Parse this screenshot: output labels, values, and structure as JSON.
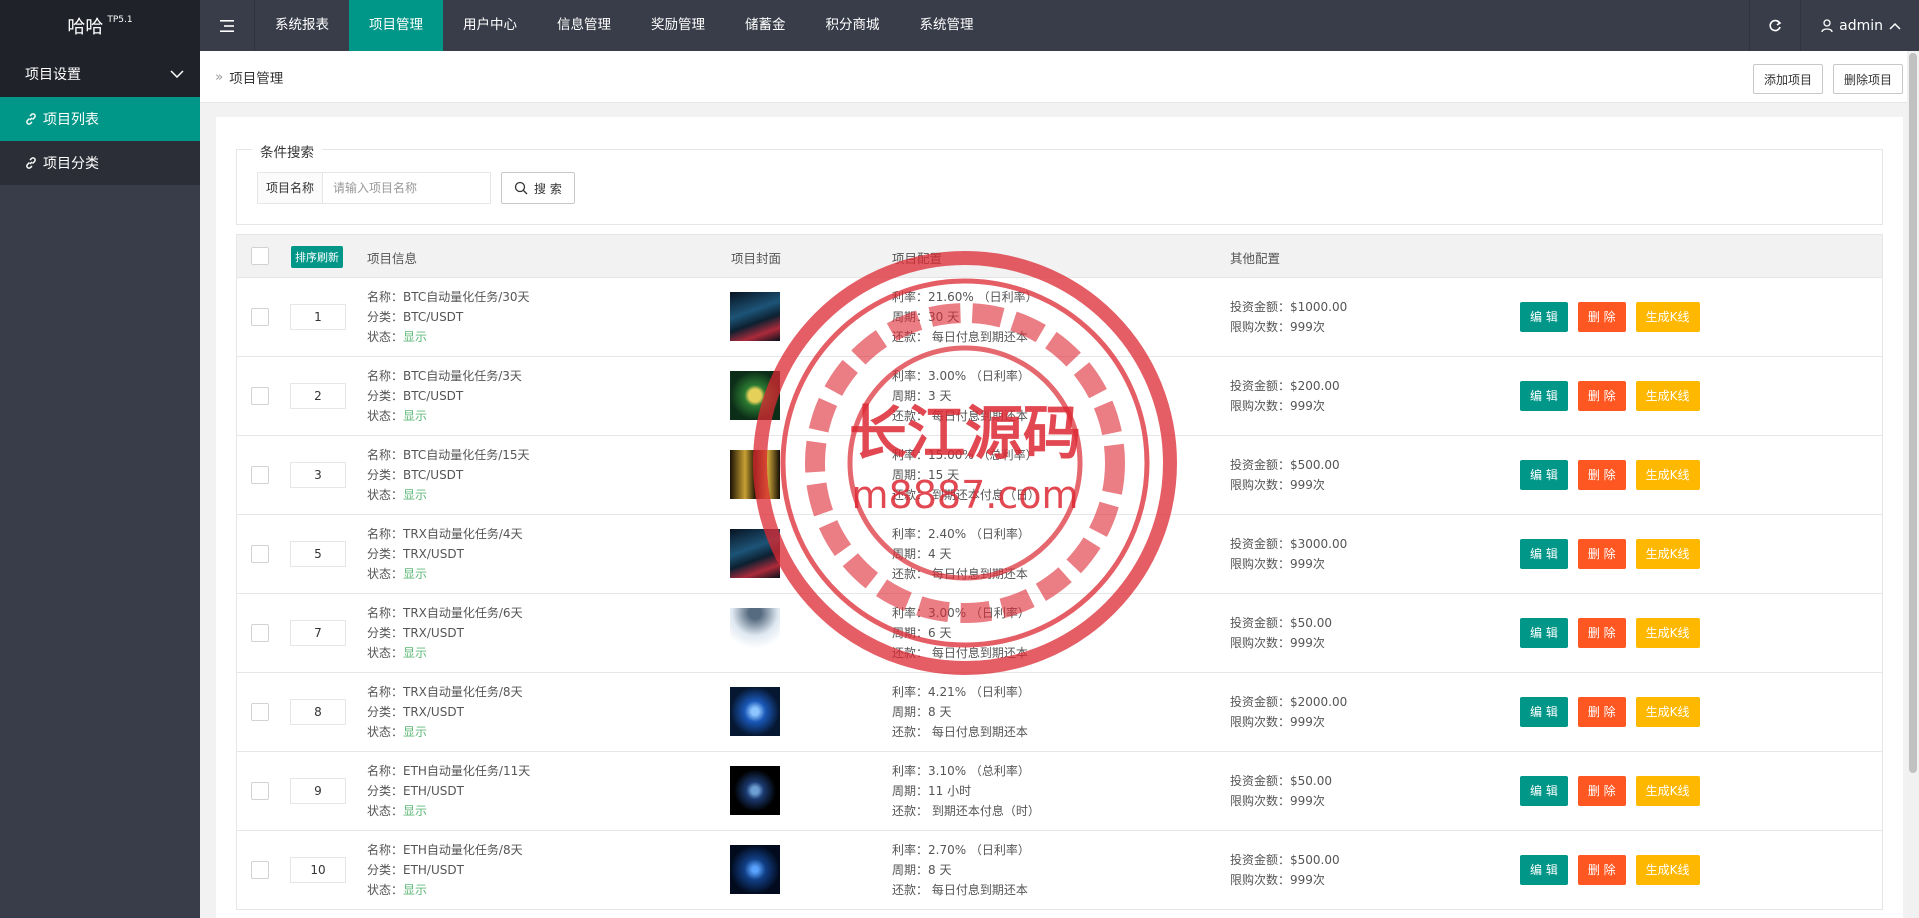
{
  "app": {
    "logo": "哈哈",
    "version": "TP5.1"
  },
  "topnav": {
    "items": [
      {
        "label": "系统报表"
      },
      {
        "label": "项目管理"
      },
      {
        "label": "用户中心"
      },
      {
        "label": "信息管理"
      },
      {
        "label": "奖励管理"
      },
      {
        "label": "储蓄金"
      },
      {
        "label": "积分商城"
      },
      {
        "label": "系统管理"
      }
    ],
    "active_index": 1,
    "user": "admin"
  },
  "sidebar": {
    "group": "项目设置",
    "items": [
      {
        "label": "项目列表",
        "active": true
      },
      {
        "label": "项目分类",
        "active": false
      }
    ]
  },
  "breadcrumb": {
    "current": "项目管理"
  },
  "toolbar": {
    "add_label": "添加项目",
    "delete_label": "删除项目"
  },
  "search": {
    "legend": "条件搜索",
    "field_label": "项目名称",
    "placeholder": "请输入项目名称",
    "button": "搜 索"
  },
  "table": {
    "sort_button": "排序刷新",
    "headers": {
      "info": "项目信息",
      "cover": "项目封面",
      "config": "项目配置",
      "other": "其他配置"
    },
    "action_labels": {
      "edit": "编 辑",
      "delete": "删 除",
      "kline": "生成K线"
    },
    "rows": [
      {
        "sort": "1",
        "name": "名称：BTC自动量化任务/30天",
        "category": "分类：BTC/USDT",
        "status_label": "状态：",
        "status": "显示",
        "rate": "利率：21.60% （日利率）",
        "period": "周期：30 天",
        "repay": "还款：  每日付息到期还本",
        "amount": "投资金额：$1000.00",
        "limit": "限购次数：999次"
      },
      {
        "sort": "2",
        "name": "名称：BTC自动量化任务/3天",
        "category": "分类：BTC/USDT",
        "status_label": "状态：",
        "status": "显示",
        "rate": "利率：3.00% （日利率）",
        "period": "周期：3 天",
        "repay": "还款：  每日付息到期还本",
        "amount": "投资金额：$200.00",
        "limit": "限购次数：999次"
      },
      {
        "sort": "3",
        "name": "名称：BTC自动量化任务/15天",
        "category": "分类：BTC/USDT",
        "status_label": "状态：",
        "status": "显示",
        "rate": "利率：15.00% （总利率）",
        "period": "周期：15 天",
        "repay": "还款：  到期还本付息（日）",
        "amount": "投资金额：$500.00",
        "limit": "限购次数：999次"
      },
      {
        "sort": "5",
        "name": "名称：TRX自动量化任务/4天",
        "category": "分类：TRX/USDT",
        "status_label": "状态：",
        "status": "显示",
        "rate": "利率：2.40% （日利率）",
        "period": "周期：4 天",
        "repay": "还款：  每日付息到期还本",
        "amount": "投资金额：$3000.00",
        "limit": "限购次数：999次"
      },
      {
        "sort": "7",
        "name": "名称：TRX自动量化任务/6天",
        "category": "分类：TRX/USDT",
        "status_label": "状态：",
        "status": "显示",
        "rate": "利率：3.00% （日利率）",
        "period": "周期：6 天",
        "repay": "还款：  每日付息到期还本",
        "amount": "投资金额：$50.00",
        "limit": "限购次数：999次"
      },
      {
        "sort": "8",
        "name": "名称：TRX自动量化任务/8天",
        "category": "分类：TRX/USDT",
        "status_label": "状态：",
        "status": "显示",
        "rate": "利率：4.21% （日利率）",
        "period": "周期：8 天",
        "repay": "还款：  每日付息到期还本",
        "amount": "投资金额：$2000.00",
        "limit": "限购次数：999次"
      },
      {
        "sort": "9",
        "name": "名称：ETH自动量化任务/11天",
        "category": "分类：ETH/USDT",
        "status_label": "状态：",
        "status": "显示",
        "rate": "利率：3.10% （总利率）",
        "period": "周期：11 小时",
        "repay": "还款：  到期还本付息（时）",
        "amount": "投资金额：$50.00",
        "limit": "限购次数：999次"
      },
      {
        "sort": "10",
        "name": "名称：ETH自动量化任务/8天",
        "category": "分类：ETH/USDT",
        "status_label": "状态：",
        "status": "显示",
        "rate": "利率：2.70% （日利率）",
        "period": "周期：8 天",
        "repay": "还款：  每日付息到期还本",
        "amount": "投资金额：$500.00",
        "limit": "限购次数：999次"
      }
    ]
  },
  "watermark": {
    "line1": "长江源码",
    "line2": "m8887.com"
  },
  "colors": {
    "primary": "#009688",
    "danger": "#ff5722",
    "warm": "#ffb800",
    "dark": "#393d49"
  }
}
